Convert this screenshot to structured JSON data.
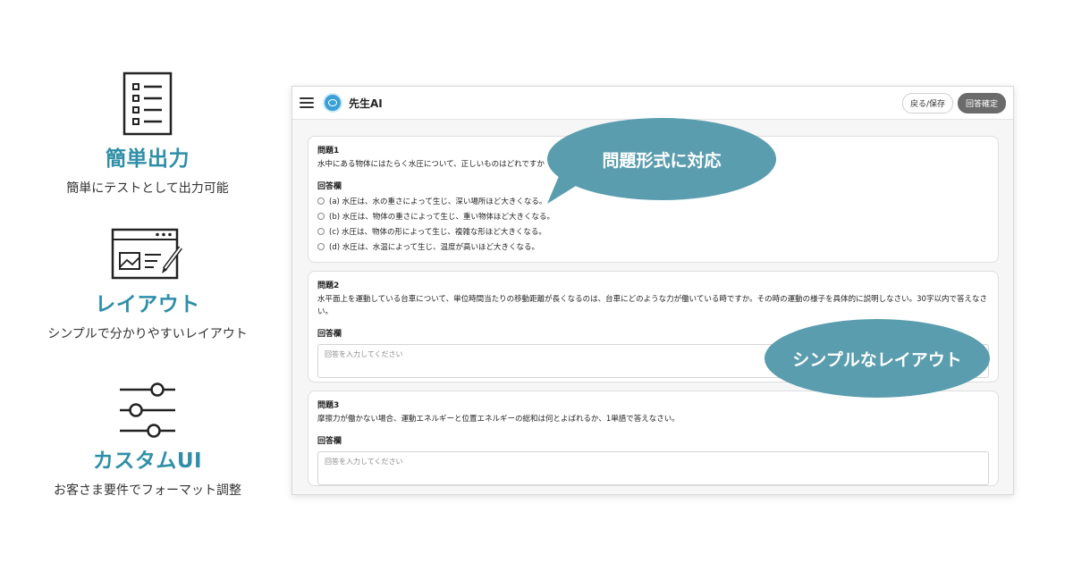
{
  "features": [
    {
      "icon": "checklist-icon",
      "title": "簡単出力",
      "description": "簡単にテストとして出力可能"
    },
    {
      "icon": "layout-window-icon",
      "title": "レイアウト",
      "description": "シンプルで分かりやすいレイアウト"
    },
    {
      "icon": "sliders-icon",
      "title": "カスタムUI",
      "description": "お客さま要件でフォーマット調整"
    }
  ],
  "app": {
    "title": "先生AI",
    "back_save_label": "戻る/保存",
    "confirm_label": "回答確定",
    "questions": [
      {
        "label": "問題1",
        "text": "水中にある物体にはたらく水圧について、正しいものはどれですか",
        "answer_label": "回答欄",
        "options": [
          "(a) 水圧は、水の重さによって生じ、深い場所ほど大きくなる。",
          "(b) 水圧は、物体の重さによって生じ、重い物体ほど大きくなる。",
          "(c) 水圧は、物体の形によって生じ、複雑な形ほど大きくなる。",
          "(d) 水圧は、水温によって生じ、温度が高いほど大きくなる。"
        ]
      },
      {
        "label": "問題2",
        "text": "水平面上を運動している台車について、単位時間当たりの移動距離が長くなるのは、台車にどのような力が働いている時ですか。その時の運動の様子を具体的に説明しなさい。30字以内で答えなさい。",
        "answer_label": "回答欄",
        "placeholder": "回答を入力してください"
      },
      {
        "label": "問題3",
        "text": "摩擦力が働かない場合、運動エネルギーと位置エネルギーの総和は何とよばれるか、1単語で答えなさい。",
        "answer_label": "回答欄",
        "placeholder": "回答を入力してください"
      }
    ]
  },
  "callouts": {
    "format": "問題形式に対応",
    "layout": "シンプルなレイアウト"
  },
  "colors": {
    "accent": "#2f8fa8",
    "callout": "#5a9dae",
    "confirm_button": "#6b6b6b"
  }
}
